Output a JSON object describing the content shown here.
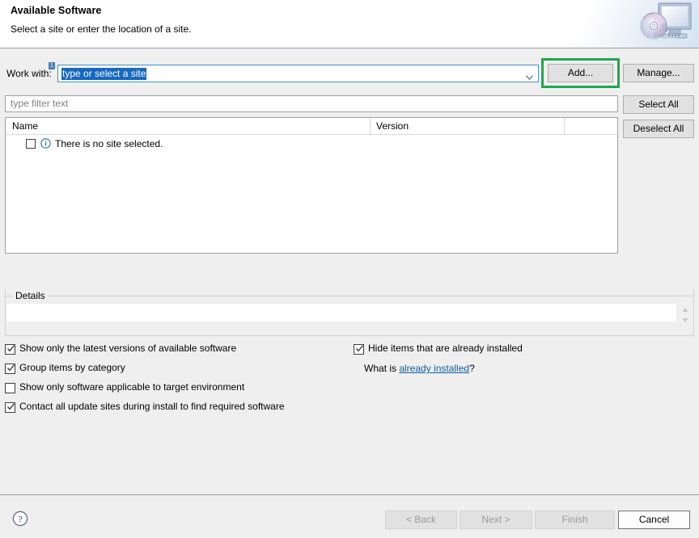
{
  "header": {
    "title": "Available Software",
    "subtitle": "Select a site or enter the location of a site.",
    "icon": "install-disc-monitor-icon"
  },
  "work_with": {
    "label": "Work with:",
    "badge": "1",
    "value": "type or select a site",
    "value_selected": true,
    "dropdown_icon": "chevron-down-icon"
  },
  "site_buttons": {
    "add_label": "Add...",
    "manage_label": "Manage..."
  },
  "annotation": {
    "target": "add-button",
    "color": "#1fa84b"
  },
  "filter": {
    "placeholder": "type filter text",
    "value": ""
  },
  "list_buttons": {
    "select_all_label": "Select All",
    "deselect_all_label": "Deselect All"
  },
  "table": {
    "columns": [
      "Name",
      "Version"
    ],
    "rows": [
      {
        "checked": false,
        "icon": "info-icon",
        "name": "There is no site selected.",
        "version": ""
      }
    ]
  },
  "details": {
    "legend": "Details",
    "text": "",
    "scroll_icon": "scroll-arrows-icon"
  },
  "options": [
    {
      "label": "Show only the latest versions of available software",
      "checked": true
    },
    {
      "label": "Group items by category",
      "checked": true
    },
    {
      "label": "Show only software applicable to target environment",
      "checked": false
    },
    {
      "label": "Contact all update sites during install to find required software",
      "checked": true
    },
    {
      "label": "Hide items that are already installed",
      "checked": true
    }
  ],
  "what_is": {
    "prefix": "What is ",
    "link": "already installed",
    "suffix": "?"
  },
  "wizard_buttons": {
    "help_icon": "help-question-icon",
    "back_label": "< Back",
    "back_enabled": false,
    "next_label": "Next >",
    "next_enabled": false,
    "finish_label": "Finish",
    "finish_enabled": false,
    "cancel_label": "Cancel",
    "cancel_enabled": true
  }
}
